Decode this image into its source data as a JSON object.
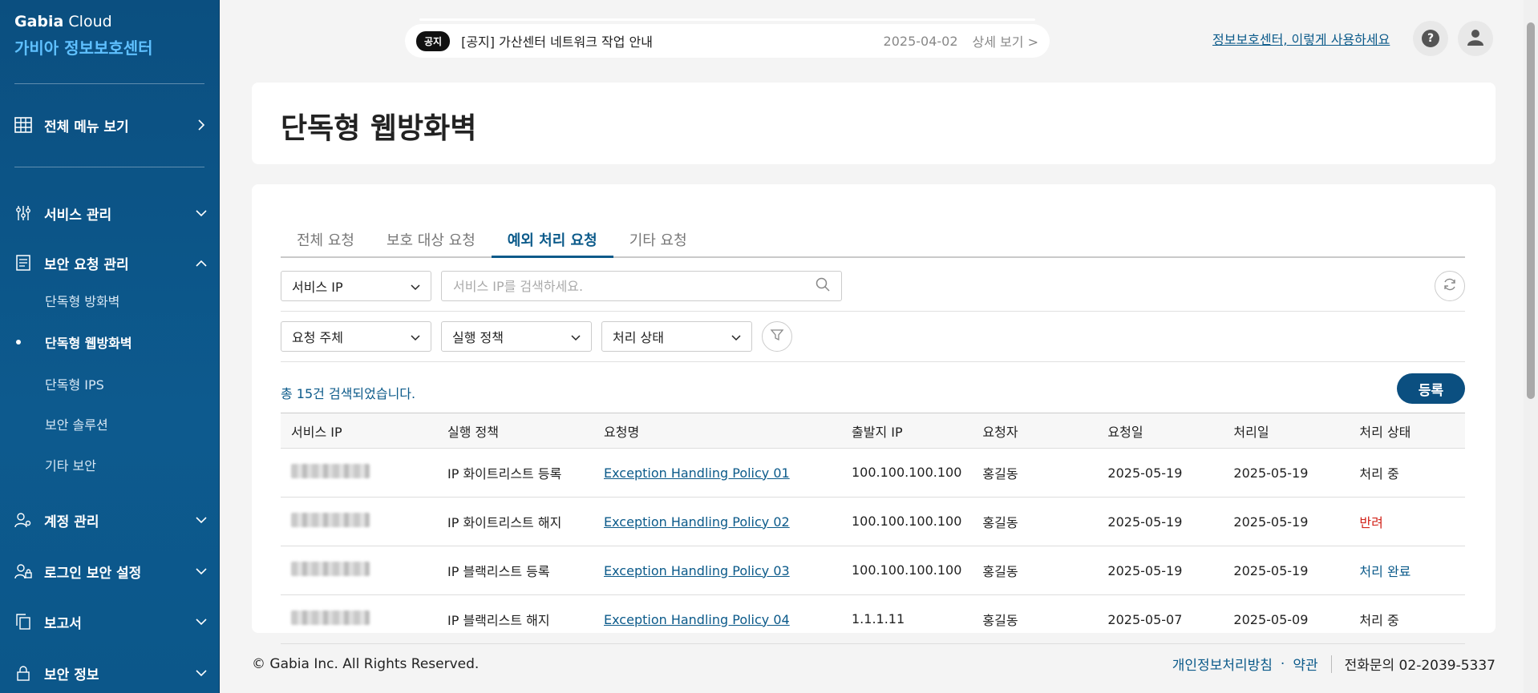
{
  "brand": {
    "cloud_bold": "Gabia",
    "cloud_rest": " Cloud",
    "center": "가비아 정보보호센터"
  },
  "sidebar": {
    "all_menu": "전체 메뉴 보기",
    "items": [
      {
        "label": "서비스 관리"
      },
      {
        "label": "보안 요청 관리"
      },
      {
        "label": "계정 관리"
      },
      {
        "label": "로그인 보안 설정"
      },
      {
        "label": "보고서"
      },
      {
        "label": "보안 정보"
      }
    ],
    "sub_items": [
      {
        "label": "단독형 방화벽"
      },
      {
        "label": "단독형 웹방화벽"
      },
      {
        "label": "단독형 IPS"
      },
      {
        "label": "보안 솔루션"
      },
      {
        "label": "기타 보안"
      }
    ]
  },
  "notice": {
    "badge": "공지",
    "title": "[공지] 가산센터 네트워크 작업 안내",
    "date": "2025-04-02",
    "link": "상세 보기 >"
  },
  "header": {
    "guide": "정보보호센터, 이렇게 사용하세요",
    "help": "?"
  },
  "page": {
    "title": "단독형 웹방화벽"
  },
  "tabs": [
    "전체 요청",
    "보호 대상 요청",
    "예외 처리 요청",
    "기타 요청"
  ],
  "filters": {
    "search_type": "서비스 IP",
    "search_placeholder": "서비스 IP를 검색하세요.",
    "requester": "요청 주체",
    "policy": "실행 정책",
    "status": "처리 상태"
  },
  "result_count": "총 15건 검색되었습니다.",
  "register_label": "등록",
  "table": {
    "headers": [
      "서비스 IP",
      "실행 정책",
      "요청명",
      "출발지 IP",
      "요청자",
      "요청일",
      "처리일",
      "처리 상태"
    ],
    "rows": [
      {
        "policy": "IP 화이트리스트 등록",
        "name": "Exception Handling Policy 01",
        "src_ip": "100.100.100.100",
        "requester": "홍길동",
        "req_date": "2025-05-19",
        "proc_date": "2025-05-19",
        "status": "처리 중"
      },
      {
        "policy": "IP 화이트리스트 해지",
        "name": "Exception Handling Policy 02",
        "src_ip": "100.100.100.100",
        "requester": "홍길동",
        "req_date": "2025-05-19",
        "proc_date": "2025-05-19",
        "status": "반려"
      },
      {
        "policy": "IP 블랙리스트 등록",
        "name": "Exception Handling Policy 03",
        "src_ip": "100.100.100.100",
        "requester": "홍길동",
        "req_date": "2025-05-19",
        "proc_date": "2025-05-19",
        "status": "처리 완료"
      },
      {
        "policy": "IP 블랙리스트 해지",
        "name": "Exception Handling Policy 04",
        "src_ip": "1.1.1.11",
        "requester": "홍길동",
        "req_date": "2025-05-07",
        "proc_date": "2025-05-09",
        "status": "처리 중"
      }
    ]
  },
  "footer": {
    "copyright": "© Gabia Inc. All Rights Reserved.",
    "privacy": "개인정보처리방침",
    "dot": "·",
    "terms": "약관",
    "phone": "전화문의 02-2039-5337"
  },
  "colors": {
    "sidebar": "#0d5486",
    "accent": "#0b5a8a",
    "brand_center": "#5fc0ff",
    "reject": "#d2231a"
  }
}
